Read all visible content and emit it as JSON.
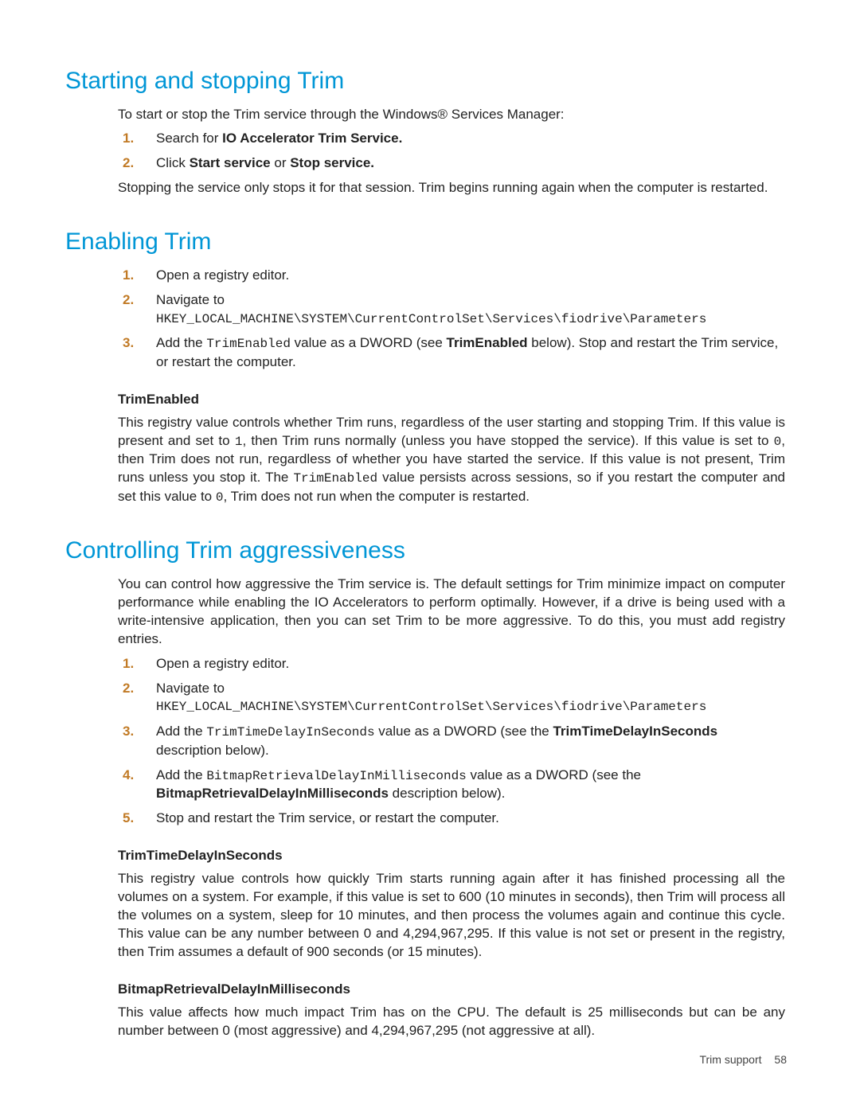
{
  "section1": {
    "title": "Starting and stopping Trim",
    "intro": "To start or stop the Trim service through the Windows® Services Manager:",
    "step1_pre": "Search for ",
    "step1_bold": "IO Accelerator Trim Service.",
    "step2_pre": "Click ",
    "step2_bold1": "Start service",
    "step2_mid": " or ",
    "step2_bold2": "Stop service.",
    "outro": "Stopping the service only stops it for that session. Trim begins running again when the computer is restarted."
  },
  "section2": {
    "title": "Enabling Trim",
    "step1": "Open a registry editor.",
    "step2_text": "Navigate to",
    "step2_code": "HKEY_LOCAL_MACHINE\\SYSTEM\\CurrentControlSet\\Services\\fiodrive\\Parameters",
    "step3_pre": "Add the ",
    "step3_code": "TrimEnabled",
    "step3_mid": " value as a DWORD (see ",
    "step3_bold": "TrimEnabled",
    "step3_post": " below). Stop and restart the Trim service, or restart the computer.",
    "sub_heading": "TrimEnabled",
    "para_pre": "This registry value controls whether Trim runs, regardless of the user starting and stopping Trim. If this value is present and set to ",
    "para_code1": "1",
    "para_mid1": ", then Trim runs normally (unless you have stopped the service). If this value is set to ",
    "para_code2": "0",
    "para_mid2": ", then Trim does not run, regardless of whether you have started the service. If this value is not present, Trim runs unless you stop it. The ",
    "para_code3": "TrimEnabled",
    "para_mid3": " value persists across sessions, so if you restart the computer and set this value to ",
    "para_code4": "0",
    "para_post": ", Trim does not run when the computer is restarted."
  },
  "section3": {
    "title": "Controlling Trim aggressiveness",
    "intro": "You can control how aggressive the Trim service is. The default settings for Trim minimize impact on computer performance while enabling the IO Accelerators to perform optimally. However, if a drive is being used with a write-intensive application, then you can set Trim to be more aggressive. To do this, you must add registry entries.",
    "step1": "Open a registry editor.",
    "step2_text": "Navigate to",
    "step2_code": "HKEY_LOCAL_MACHINE\\SYSTEM\\CurrentControlSet\\Services\\fiodrive\\Parameters",
    "step3_pre": "Add the ",
    "step3_code": "TrimTimeDelayInSeconds",
    "step3_mid": " value as a DWORD (see the ",
    "step3_bold": "TrimTimeDelayInSeconds",
    "step3_post": " description below).",
    "step4_pre": "Add the ",
    "step4_code": "BitmapRetrievalDelayInMilliseconds",
    "step4_mid": " value as a DWORD (see the ",
    "step4_bold": "BitmapRetrievalDelayInMilliseconds",
    "step4_post": " description below).",
    "step5": "Stop and restart the Trim service, or restart the computer.",
    "sub1_heading": "TrimTimeDelayInSeconds",
    "sub1_para": "This registry value controls how quickly Trim starts running again after it has finished processing all the volumes on a system. For example, if this value is set to 600 (10 minutes in seconds), then Trim will process all the volumes on a system, sleep for 10 minutes, and then process the volumes again and continue this cycle. This value can be any number between 0 and 4,294,967,295. If this value is not set or present in the registry, then Trim assumes a default of 900 seconds (or 15 minutes).",
    "sub2_heading": "BitmapRetrievalDelayInMilliseconds",
    "sub2_para": "This value affects how much impact Trim has on the CPU. The default is 25 milliseconds but can be any number between 0 (most aggressive) and 4,294,967,295 (not aggressive at all)."
  },
  "nums": {
    "n1": "1.",
    "n2": "2.",
    "n3": "3.",
    "n4": "4.",
    "n5": "5."
  },
  "footer": {
    "label": "Trim support",
    "page": "58"
  }
}
